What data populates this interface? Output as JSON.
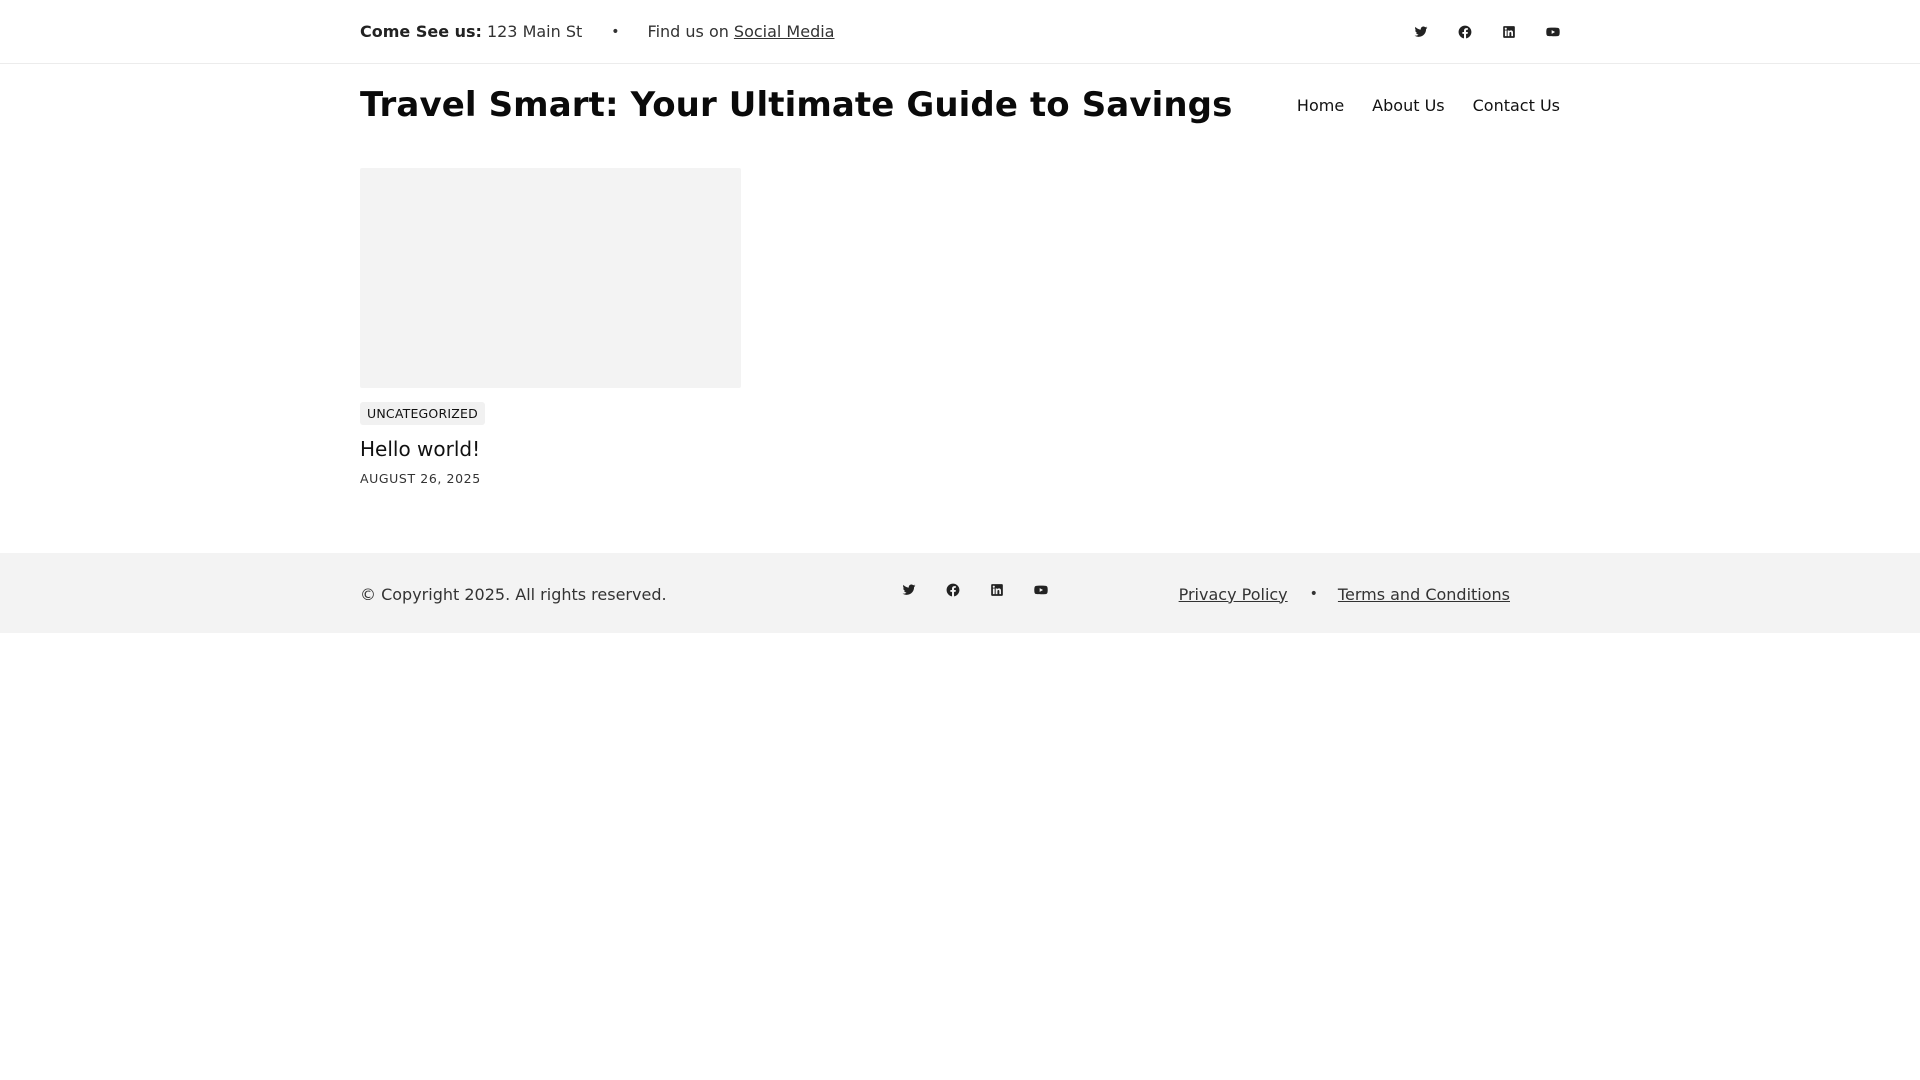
{
  "topbar": {
    "visit_label": "Come See us:",
    "address": "123 Main St",
    "separator": "•",
    "find_prefix": "Find us on",
    "social_link": "Social Media",
    "social_icons": [
      "twitter-icon",
      "facebook-icon",
      "linkedin-icon",
      "youtube-icon"
    ]
  },
  "header": {
    "site_title": "Travel Smart: Your Ultimate Guide to Savings",
    "nav": [
      "Home",
      "About Us",
      "Contact Us"
    ]
  },
  "posts": [
    {
      "category": "UNCATEGORIZED",
      "title": "Hello world!",
      "date": "AUGUST 26, 2025"
    }
  ],
  "footer": {
    "copyright": "© Copyright 2025. All rights reserved.",
    "social_icons": [
      "twitter-icon",
      "facebook-icon",
      "linkedin-icon",
      "youtube-icon"
    ],
    "links": [
      "Privacy Policy",
      "Terms and Conditions"
    ],
    "separator": "•"
  },
  "colors": {
    "text": "#111111",
    "footer_bg": "#f3f3f3",
    "thumb_bg": "#f3f3f3",
    "badge_bg": "#f1f1f1"
  }
}
